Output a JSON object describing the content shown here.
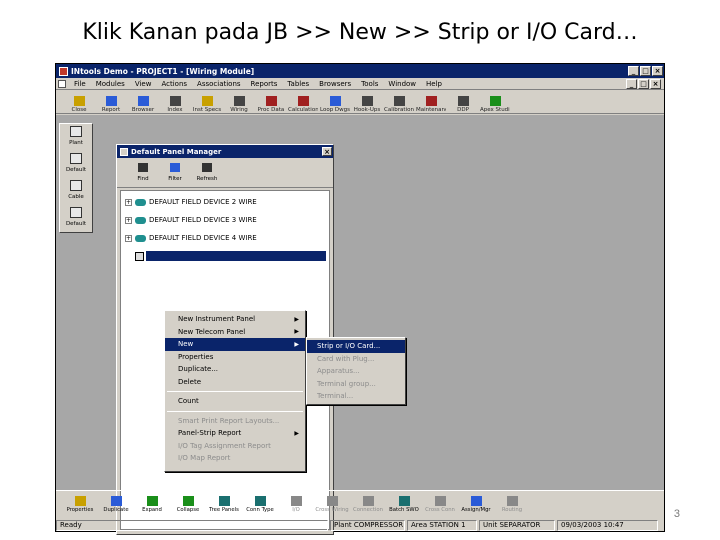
{
  "slide": {
    "title": "Klik Kanan pada JB >> New >> Strip or I/O Card…",
    "page_number": "3"
  },
  "window": {
    "title": "INtools Demo - PROJECT1 - [Wiring Module]",
    "menu": [
      "File",
      "Modules",
      "View",
      "Actions",
      "Associations",
      "Reports",
      "Tables",
      "Browsers",
      "Tools",
      "Window",
      "Help"
    ],
    "toolbar": [
      {
        "label": "Close",
        "icon": "close-tool-icon",
        "color": "#c8a000"
      },
      {
        "label": "Report",
        "icon": "report-icon",
        "color": "#2a5bd7"
      },
      {
        "label": "Browser",
        "icon": "browser-icon",
        "color": "#2a5bd7"
      },
      {
        "label": "Index",
        "icon": "index-icon",
        "color": "#444444"
      },
      {
        "label": "Inst Specs",
        "icon": "inst-specs-icon",
        "color": "#c8a000"
      },
      {
        "label": "Wiring",
        "icon": "wiring-icon",
        "color": "#444444"
      },
      {
        "label": "Proc Data",
        "icon": "proc-data-icon",
        "color": "#a02020"
      },
      {
        "label": "Calculation",
        "icon": "calculation-icon",
        "color": "#a02020"
      },
      {
        "label": "Loop Dwgs",
        "icon": "loop-dwgs-icon",
        "color": "#2a5bd7"
      },
      {
        "label": "Hook-Ups",
        "icon": "hook-ups-icon",
        "color": "#444444"
      },
      {
        "label": "Calibration",
        "icon": "calibration-icon",
        "color": "#444444"
      },
      {
        "label": "Maintenance",
        "icon": "maintenance-icon",
        "color": "#a02020"
      },
      {
        "label": "DDP",
        "icon": "ddp-icon",
        "color": "#444444"
      },
      {
        "label": "Apex Studio Conversion",
        "icon": "apex-icon",
        "color": "#1a8f1a"
      }
    ],
    "sidebar": [
      {
        "label": "Plant",
        "icon": "plant-icon"
      },
      {
        "label": "Default",
        "icon": "default-icon"
      },
      {
        "label": "Cable",
        "icon": "cable-icon"
      },
      {
        "label": "Default",
        "icon": "default-icon"
      }
    ]
  },
  "dialog": {
    "title": "Default Panel Manager",
    "tools": [
      {
        "label": "Find",
        "icon": "binoculars-icon"
      },
      {
        "label": "Filter",
        "icon": "filter-icon"
      },
      {
        "label": "Refresh",
        "icon": "refresh-icon"
      }
    ],
    "tree": [
      {
        "label": "DEFAULT FIELD DEVICE 2 WIRE"
      },
      {
        "label": "DEFAULT FIELD DEVICE 3 WIRE"
      },
      {
        "label": "DEFAULT FIELD DEVICE 4 WIRE"
      }
    ]
  },
  "context_menu": {
    "items": [
      {
        "label": "New Instrument Panel",
        "submenu": true,
        "state": "normal"
      },
      {
        "label": "New Telecom Panel",
        "submenu": true,
        "state": "normal"
      },
      {
        "label": "New",
        "submenu": true,
        "state": "active"
      },
      {
        "label": "Properties",
        "submenu": false,
        "state": "normal"
      },
      {
        "label": "Duplicate...",
        "submenu": false,
        "state": "normal"
      },
      {
        "label": "Delete",
        "submenu": false,
        "state": "normal"
      },
      {
        "separator": true
      },
      {
        "label": "Count",
        "submenu": false,
        "state": "normal"
      },
      {
        "separator": true
      },
      {
        "label": "Smart Print Report Layouts...",
        "submenu": false,
        "state": "disabled"
      },
      {
        "label": "Panel-Strip Report",
        "submenu": true,
        "state": "normal"
      },
      {
        "label": "I/O Tag Assignment Report",
        "submenu": false,
        "state": "disabled"
      },
      {
        "label": "I/O Map Report",
        "submenu": false,
        "state": "disabled"
      }
    ]
  },
  "submenu": {
    "items": [
      {
        "label": "Strip or I/O Card...",
        "state": "active"
      },
      {
        "label": "Card with Plug...",
        "state": "disabled"
      },
      {
        "label": "Apparatus...",
        "state": "disabled"
      },
      {
        "label": "Terminal group...",
        "state": "disabled"
      },
      {
        "label": "Terminal...",
        "state": "disabled"
      }
    ]
  },
  "bottom_toolbar": [
    {
      "label": "Properties",
      "icon": "properties-icon",
      "color": "#c8a000",
      "state": "normal"
    },
    {
      "label": "Duplicate",
      "icon": "duplicate-icon",
      "color": "#2a5bd7",
      "state": "normal"
    },
    {
      "label": "Expand",
      "icon": "expand-icon",
      "color": "#1a8f1a",
      "state": "normal"
    },
    {
      "label": "Collapse",
      "icon": "collapse-icon",
      "color": "#1a8f1a",
      "state": "normal"
    },
    {
      "label": "Tree Panels",
      "icon": "tree-panels-icon",
      "color": "#1a6f6f",
      "state": "normal"
    },
    {
      "label": "Conn Type",
      "icon": "conn-type-icon",
      "color": "#1a6f6f",
      "state": "normal"
    },
    {
      "label": "I/O",
      "icon": "io-icon",
      "color": "#888888",
      "state": "disabled"
    },
    {
      "label": "Cross Wiring",
      "icon": "cross-wiring-icon",
      "color": "#888888",
      "state": "disabled"
    },
    {
      "label": "Connection",
      "icon": "connection-icon",
      "color": "#888888",
      "state": "disabled"
    },
    {
      "label": "Batch SWO",
      "icon": "batch-swo-icon",
      "color": "#1a6f6f",
      "state": "normal"
    },
    {
      "label": "Cross Conn",
      "icon": "cross-conn-icon",
      "color": "#888888",
      "state": "disabled"
    },
    {
      "label": "Assign/Mgr",
      "icon": "assign-mgr-icon",
      "color": "#2a5bd7",
      "state": "normal"
    },
    {
      "label": "Routing",
      "icon": "routing-icon",
      "color": "#888888",
      "state": "disabled"
    }
  ],
  "status": {
    "ready": "Ready",
    "plant": "Plant COMPRESSOR",
    "area": "Area STATION 1",
    "unit": "Unit SEPARATOR",
    "datetime": "09/03/2003 10:47"
  }
}
